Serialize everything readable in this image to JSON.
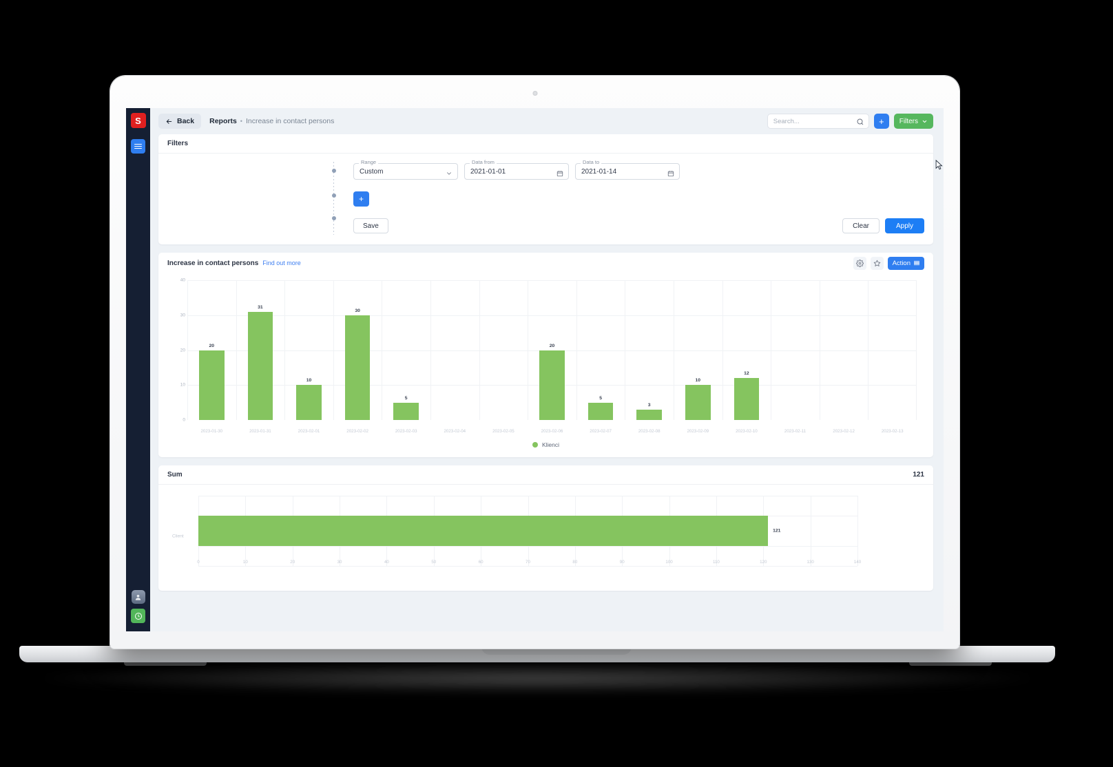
{
  "app": {
    "logo_text": "S",
    "sidebar": {
      "items": [
        {
          "name": "logo",
          "icon": "logo-icon",
          "label": "S"
        },
        {
          "name": "menu",
          "icon": "hamburger-icon",
          "label": ""
        }
      ],
      "bottom": [
        {
          "name": "account",
          "icon": "avatar-icon",
          "label": ""
        },
        {
          "name": "timer",
          "icon": "clock-icon",
          "label": ""
        }
      ]
    }
  },
  "topbar": {
    "back_label": "Back",
    "back_icon": "arrow-left-icon",
    "breadcrumb_root": "Reports",
    "breadcrumb_sep": "•",
    "breadcrumb_leaf": "Increase in contact persons",
    "search_placeholder": "Search...",
    "search_value": "",
    "search_icon": "search-icon",
    "add_label": "+",
    "filters_label": "Filters",
    "filters_chevron": "chevron-down-icon",
    "filters_color": "#56b75e",
    "add_color": "#2f7ef0"
  },
  "filters": {
    "title": "Filters",
    "range": {
      "label": "Range",
      "value": "Custom",
      "options": [
        "Custom"
      ]
    },
    "date_from": {
      "label": "Data from",
      "value": "2021-01-01"
    },
    "date_to": {
      "label": "Data to",
      "value": "2021-01-14"
    },
    "add_label": "+",
    "save_label": "Save",
    "clear_label": "Clear",
    "apply_label": "Apply",
    "apply_color": "#1d7ef5"
  },
  "report": {
    "title": "Increase in contact persons",
    "find_out_more": "Find out more",
    "settings_icon": "gear-icon",
    "favorite_icon": "star-icon",
    "action_label": "Action",
    "action_icon": "list-lines-icon"
  },
  "sum": {
    "title": "Sum",
    "value": "121"
  },
  "chart_data": [
    {
      "type": "bar",
      "title": "Increase in contact persons",
      "xlabel": "",
      "ylabel": "",
      "ylim": [
        0,
        40
      ],
      "yticks": [
        0,
        10,
        20,
        30,
        40
      ],
      "grid": true,
      "legend": {
        "position": "bottom",
        "entries": [
          "Klienci"
        ]
      },
      "series": [
        {
          "name": "Klienci",
          "color": "#85c45f",
          "values": [
            20,
            31,
            10,
            30,
            5,
            0,
            0,
            20,
            5,
            3,
            10,
            12,
            0,
            0,
            0
          ]
        }
      ],
      "categories": [
        "2023-01-30",
        "2023-01-31",
        "2023-02-01",
        "2023-02-02",
        "2023-02-03",
        "2023-02-04",
        "2023-02-05",
        "2023-02-06",
        "2023-02-07",
        "2023-02-08",
        "2023-02-09",
        "2023-02-10",
        "2023-02-11",
        "2023-02-12",
        "2023-02-13"
      ],
      "data_labels": [
        "20",
        "31",
        "10",
        "30",
        "5",
        "",
        "",
        "20",
        "5",
        "3",
        "10",
        "12",
        "",
        "",
        ""
      ]
    },
    {
      "type": "bar",
      "orientation": "horizontal",
      "title": "Sum",
      "categories": [
        "Client"
      ],
      "values": [
        121
      ],
      "data_labels": [
        "121"
      ],
      "color": "#85c45f",
      "xlim": [
        0,
        140
      ],
      "xticks": [
        0,
        10,
        20,
        30,
        40,
        50,
        60,
        70,
        80,
        90,
        100,
        110,
        120,
        130,
        140
      ],
      "grid": true
    }
  ]
}
